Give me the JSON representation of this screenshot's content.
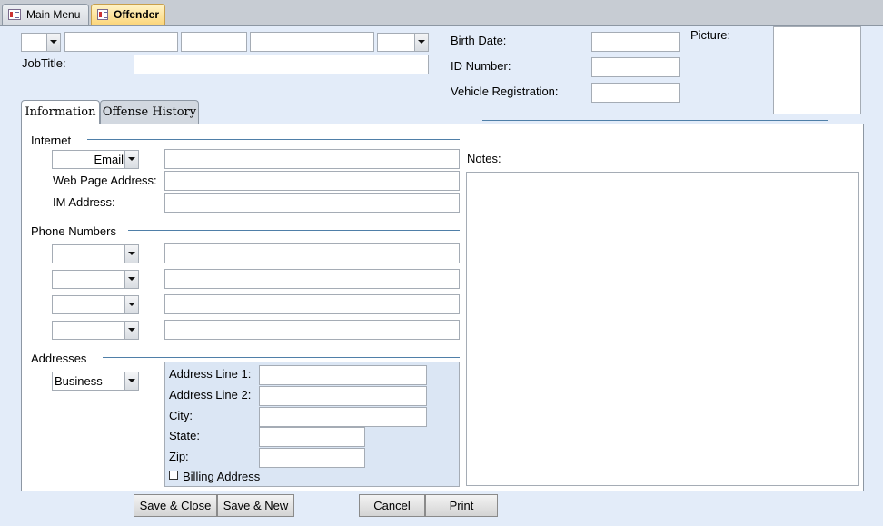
{
  "tabs": {
    "main_menu": "Main Menu",
    "offender": "Offender"
  },
  "header": {
    "job_title_label": "JobTitle:",
    "birth_date_label": "Birth Date:",
    "id_number_label": "ID Number:",
    "vehicle_label": "Vehicle Registration:",
    "picture_label": "Picture:"
  },
  "page_tabs": {
    "information": "Information",
    "offense_history": "Offense History"
  },
  "internet": {
    "section_label": "Internet",
    "email_combo": "Email",
    "web_label": "Web Page Address:",
    "im_label": "IM Address:"
  },
  "phones": {
    "section_label": "Phone Numbers"
  },
  "addresses": {
    "section_label": "Addresses",
    "type_combo": "Business",
    "line1_label": "Address Line 1:",
    "line2_label": "Address Line 2:",
    "city_label": "City:",
    "state_label": "State:",
    "zip_label": "Zip:",
    "billing_label": "Billing Address"
  },
  "notes_label": "Notes:",
  "buttons": {
    "save_close": "Save & Close",
    "save_new": "Save & New",
    "cancel": "Cancel",
    "print": "Print"
  }
}
